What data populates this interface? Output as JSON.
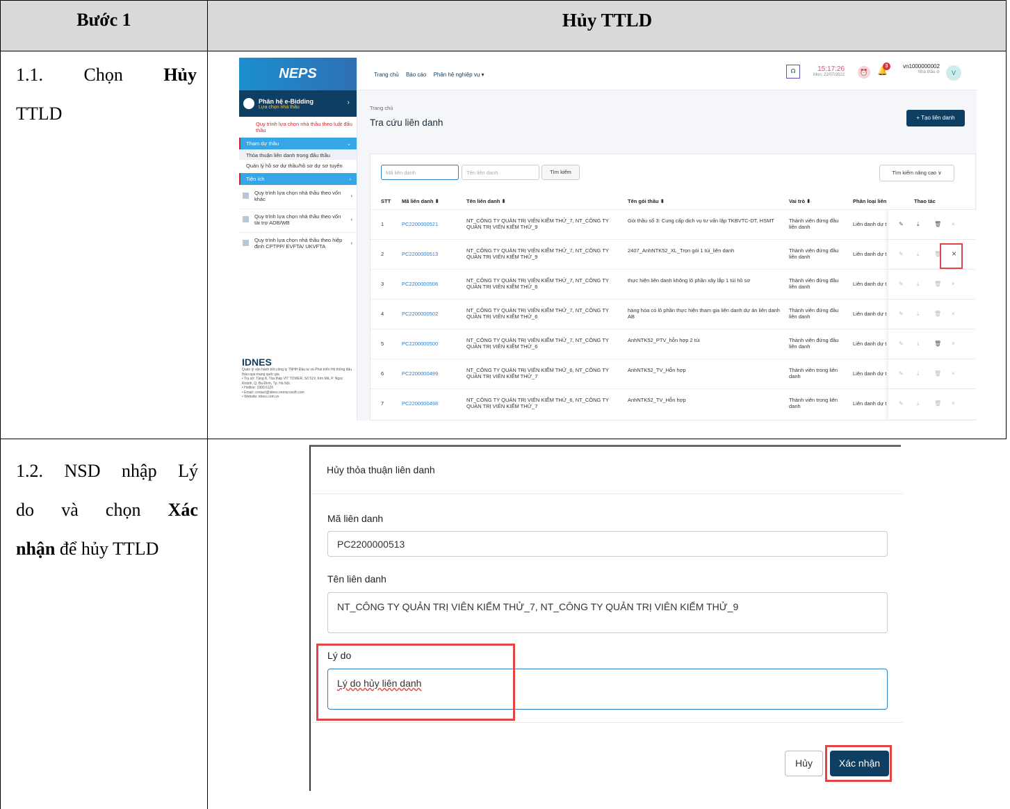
{
  "header": {
    "step": "Bước 1",
    "title": "Hủy TTLD"
  },
  "steps": {
    "s11": {
      "num": "1.1.",
      "word": "Chọn",
      "bold": "Hủy",
      "rest": "TTLD"
    },
    "s12": {
      "l1a": "1.2.",
      "l1b": "NSD",
      "l1c": "nhập",
      "l1d": "Lý",
      "l2a": "do",
      "l2b": "và",
      "l2c": "chọn",
      "l2d": "Xác",
      "l3a": "nhận",
      "l3b": "để hủy TTLD"
    }
  },
  "app": {
    "logo": "NEPS",
    "module_title": "Phân hệ e-Bidding",
    "module_sub": "Lựa chọn nhà thầu",
    "menu_red": "Quy trình lựa chọn nhà thầu theo luật đấu thầu",
    "menu_tham_du": "Tham dự thầu",
    "sub_1": "Thỏa thuận liên danh trong đấu thầu",
    "sub_2": "Quản lý hồ sơ dự thầu/hồ sơ dự sơ tuyển",
    "menu_tien_ich": "Tiện ích",
    "item_1": "Quy trình lựa chọn nhà thầu theo vốn khác",
    "item_2": "Quy trình lựa chọn nhà thầu theo vốn tài trợ ADB/WB",
    "item_3": "Quy trình lựa chọn nhà thầu theo hiệp định CPTPP/ EVFTA/ UKVFTA",
    "idnes_logo": "IDNES",
    "idnes_l1": "Quản lý vận hành bởi công ty TNHH Đầu tư và Phát triển Hệ thống đấu thầu qua mạng quốc gia",
    "idnes_l2": "• Trụ sở: Tầng 8, Tòa tháp VIT TOWER, Số 519, Kim Mã, P. Ngọc Khánh, Q. Ba Đình, Tp. Hà Nội.",
    "idnes_l3": "• Hotline: 1900 6126",
    "idnes_l4": "• Email: contact@idnes.onmicrosoft.com",
    "idnes_l5": "• Website: idnes.com.vn",
    "nav_home": "Trang chủ",
    "nav_report": "Báo cáo",
    "nav_module": "Phân hệ nghiệp vụ ▾",
    "time": "15:17:26",
    "date": "Mon, 22/07/2022",
    "bell_count": "3",
    "username": "vn1000000002",
    "role": "Nhà thầu ⊘",
    "avatar": "V",
    "crumb": "Trang chủ",
    "page_title": "Tra cứu liên danh",
    "create_btn": "+ Tạo liên danh",
    "ph_ma": "Mã liên danh",
    "ph_ten": "Tên liên danh",
    "search_btn": "Tìm kiếm",
    "adv_btn": "Tìm kiếm nâng cao ∨",
    "th": {
      "stt": "STT",
      "ma": "Mã liên danh ⬍",
      "ten": "Tên liên danh ⬍",
      "goi": "Tên gói thầu ⬍",
      "vai": "Vai trò ⬍",
      "loai": "Phân loại liên",
      "thao": "Thao tác"
    },
    "rows": [
      {
        "stt": "1",
        "ma": "PC2200000521",
        "ten": "NT_CÔNG TY QUẢN TRỊ VIÊN KIỂM THỬ_7, NT_CÔNG TY QUẢN TRỊ VIÊN KIỂM THỬ_9",
        "goi": "Gói thầu số 3: Cung cấp dịch vụ tư vấn lập TKBVTC-DT, HSMT",
        "vai": "Thành viên đứng đầu liên danh",
        "loai": "Liên danh dự t"
      },
      {
        "stt": "2",
        "ma": "PC2200000513",
        "ten": "NT_CÔNG TY QUẢN TRỊ VIÊN KIỂM THỬ_7, NT_CÔNG TY QUẢN TRỊ VIÊN KIỂM THỬ_9",
        "goi": "2407_AnhNTK52_XL_Trọn gói 1 túi_liên danh",
        "vai": "Thành viên đứng đầu liên danh",
        "loai": "Liên danh dự t"
      },
      {
        "stt": "3",
        "ma": "PC2200000506",
        "ten": "NT_CÔNG TY QUẢN TRỊ VIÊN KIỂM THỬ_7, NT_CÔNG TY QUẢN TRỊ VIÊN KIỂM THỬ_6",
        "goi": "thực hiện liên danh không lô phần xây lắp 1 túi hồ sơ",
        "vai": "Thành viên đứng đầu liên danh",
        "loai": "Liên danh dự t"
      },
      {
        "stt": "4",
        "ma": "PC2200000502",
        "ten": "NT_CÔNG TY QUẢN TRỊ VIÊN KIỂM THỬ_7, NT_CÔNG TY QUẢN TRỊ VIÊN KIỂM THỬ_6",
        "goi": "hàng hóa có lô phần thực hiện tham gia liên danh dự án liên danh AB",
        "vai": "Thành viên đứng đầu liên danh",
        "loai": "Liên danh dự t"
      },
      {
        "stt": "5",
        "ma": "PC2200000500",
        "ten": "NT_CÔNG TY QUẢN TRỊ VIÊN KIỂM THỬ_7, NT_CÔNG TY QUẢN TRỊ VIÊN KIỂM THỬ_6",
        "goi": "AnhNTK52_PTV_hỗn hợp 2 túi",
        "vai": "Thành viên đứng đầu liên danh",
        "loai": "Liên danh dự t"
      },
      {
        "stt": "6",
        "ma": "PC2200000499",
        "ten": "NT_CÔNG TY QUẢN TRỊ VIÊN KIỂM THỬ_6, NT_CÔNG TY QUẢN TRỊ VIÊN KIỂM THỬ_7",
        "goi": "AnhNTK52_TV_Hỗn hợp",
        "vai": "Thành viên trong liên danh",
        "loai": "Liên danh dự t"
      },
      {
        "stt": "7",
        "ma": "PC2200000498",
        "ten": "NT_CÔNG TY QUẢN TRỊ VIÊN KIỂM THỬ_6, NT_CÔNG TY QUẢN TRỊ VIÊN KIỂM THỬ_7",
        "goi": "AnhNTK52_TV_Hỗn hợp",
        "vai": "Thành viên trong liên danh",
        "loai": "Liên danh dự t"
      }
    ],
    "icons": {
      "edit": "✎",
      "download": "⤓",
      "delete": "🗑",
      "cancel": "×"
    }
  },
  "dialog": {
    "title": "Hủy thỏa thuận liên danh",
    "lbl_ma": "Mã liên danh",
    "val_ma": "PC2200000513",
    "lbl_ten": "Tên liên danh",
    "val_ten": "NT_CÔNG TY QUẢN TRỊ VIÊN KIỂM THỬ_7, NT_CÔNG TY QUẢN TRỊ VIÊN KIỂM THỬ_9",
    "lbl_ly_do": "Lý do",
    "val_ly_do": "Lý do hủy liên danh",
    "btn_cancel": "Hủy",
    "btn_ok": "Xác nhận"
  },
  "colors": {
    "header_bg": "#d9d9d9",
    "brand_dark": "#0e3f62",
    "highlight": "#e14646",
    "link": "#2d7ec8"
  }
}
